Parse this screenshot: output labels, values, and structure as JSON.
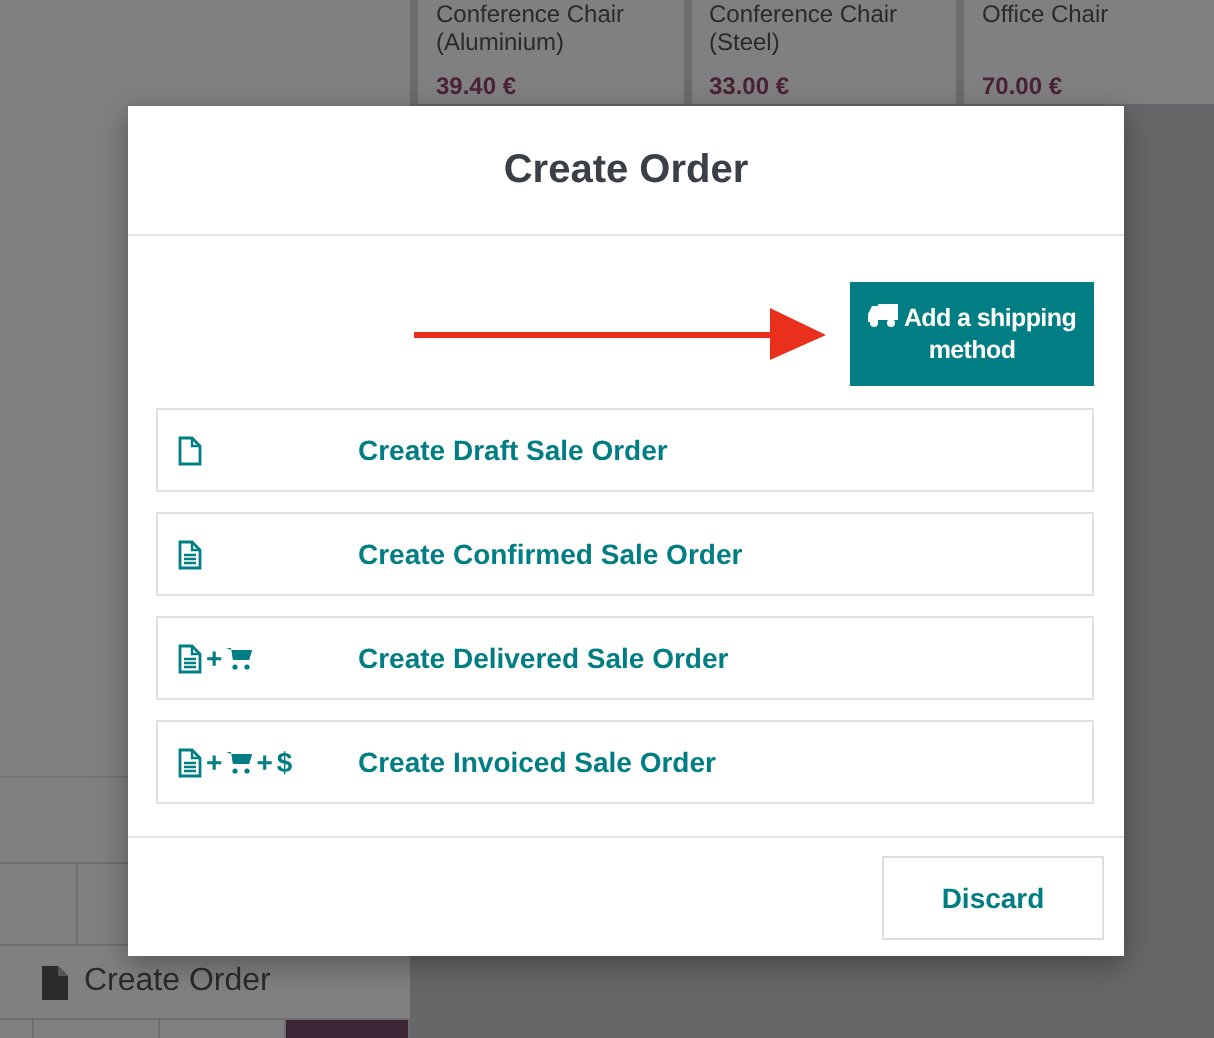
{
  "products": [
    {
      "name": "Conference Chair (Aluminium)",
      "price": "39.40 €"
    },
    {
      "name": "Conference Chair (Steel)",
      "price": "33.00 €"
    },
    {
      "name": "Office Chair",
      "price": "70.00 €"
    }
  ],
  "left_panel": {
    "create_order_button": "Create Order"
  },
  "dialog": {
    "title": "Create Order",
    "shipping_button": "Add a shipping method",
    "options": [
      {
        "label": "Create Draft Sale Order",
        "icons": [
          {
            "kind": "document"
          }
        ]
      },
      {
        "label": "Create Confirmed Sale Order",
        "icons": [
          {
            "kind": "document-lines"
          }
        ]
      },
      {
        "label": "Create Delivered Sale Order",
        "icons": [
          {
            "kind": "document-lines"
          },
          {
            "kind": "glyph",
            "text": "+"
          },
          {
            "kind": "cart"
          }
        ]
      },
      {
        "label": "Create Invoiced Sale Order",
        "icons": [
          {
            "kind": "document-lines"
          },
          {
            "kind": "glyph",
            "text": "+"
          },
          {
            "kind": "cart"
          },
          {
            "kind": "glyph",
            "text": "+"
          },
          {
            "kind": "glyph",
            "text": "$"
          }
        ]
      }
    ],
    "discard_button": "Discard"
  }
}
